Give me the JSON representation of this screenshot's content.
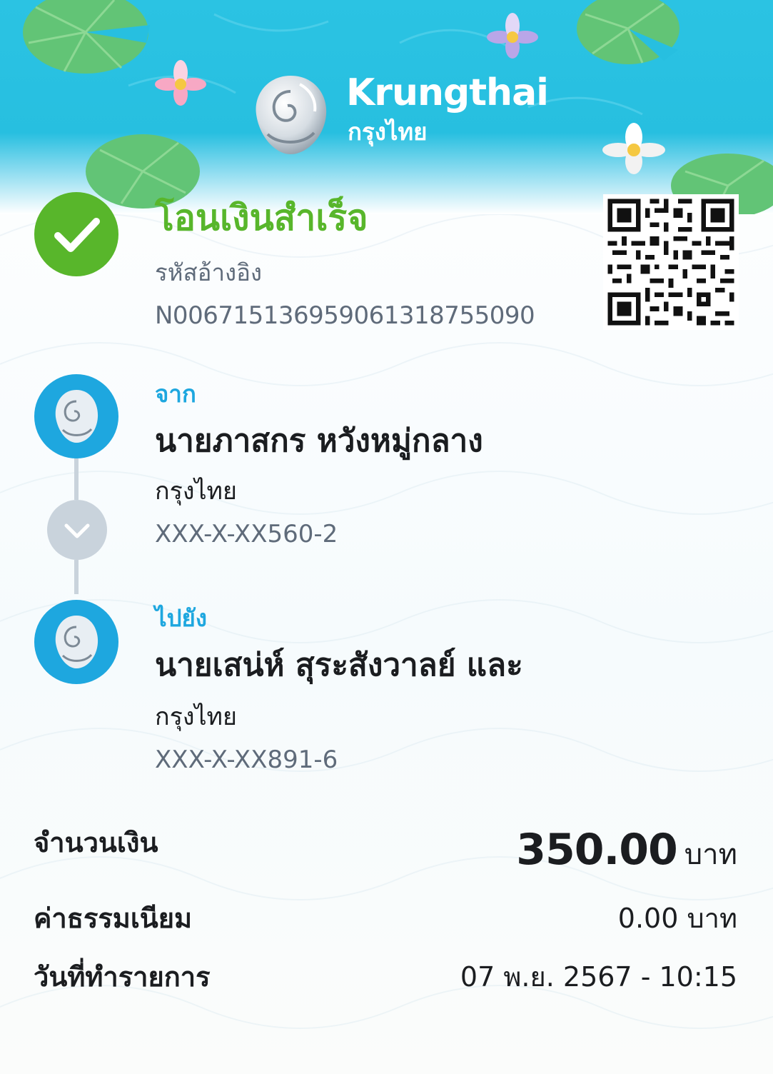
{
  "brand": {
    "name_en": "Krungthai",
    "name_th": "กรุงไทย"
  },
  "status": {
    "title": "โอนเงินสำเร็จ",
    "reference_label": "รหัสอ้างอิง",
    "reference_value": "N006715136959061318755090"
  },
  "from": {
    "label": "จาก",
    "name": "นายภาสกร หวังหมู่กลาง",
    "bank": "กรุงไทย",
    "account": "XXX-X-XX560-2"
  },
  "to": {
    "label": "ไปยัง",
    "name": "นายเสน่ห์ สุระสังวาลย์ และ",
    "bank": "กรุงไทย",
    "account": "XXX-X-XX891-6"
  },
  "summary": {
    "amount_label": "จำนวนเงิน",
    "amount_value": "350.00",
    "amount_unit": "บาท",
    "fee_label": "ค่าธรรมเนียม",
    "fee_value": "0.00 บาท",
    "date_label": "วันที่ทำรายการ",
    "date_value": "07 พ.ย. 2567 - 10:15"
  },
  "colors": {
    "header_blue": "#27bfe0",
    "success_green": "#58b62b",
    "label_blue": "#1ea7df",
    "muted_text": "#5f6b7a",
    "connector_gray": "#c9d3dc"
  },
  "icons": [
    "success-check-icon",
    "qr-code-icon",
    "krungthai-logo-icon",
    "chevron-down-icon"
  ]
}
